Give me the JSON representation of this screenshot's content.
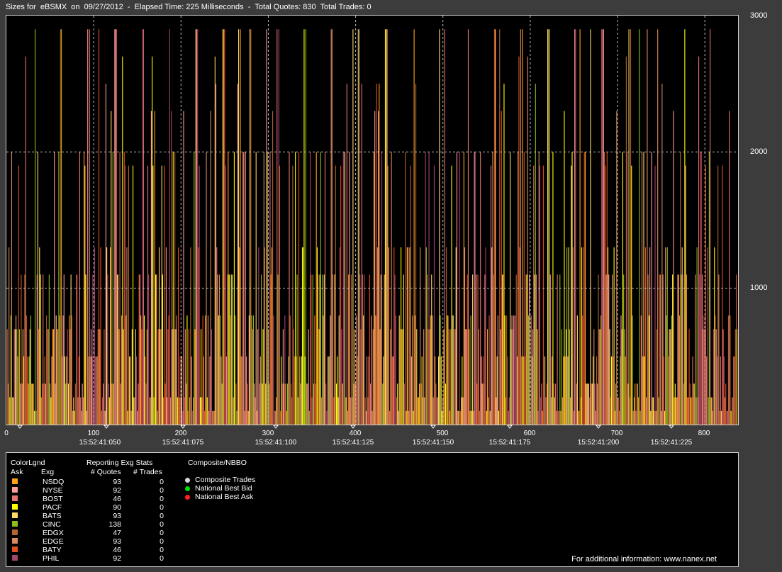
{
  "title": "Sizes for  eBSMX  on  09/27/2012  -  Elapsed Time: 225 Milliseconds  -  Total Quotes: 830  Total Trades: 0",
  "chart_data": {
    "type": "bar",
    "ylim": [
      0,
      3000
    ],
    "yticks": [
      "3000",
      "2000",
      "1000"
    ],
    "xlim": [
      0,
      838
    ],
    "xticks": [
      "0",
      "100",
      "200",
      "300",
      "400",
      "500",
      "600",
      "700",
      "800"
    ],
    "time_ticks": [
      "15:52:41:050",
      "15:52:41:075",
      "15:52:41:100",
      "15:52:41:125",
      "15:52:41:150",
      "15:52:41:175",
      "15:52:41:200",
      "15:52:41:225"
    ],
    "grid": true,
    "size_levels": [
      2900,
      2700,
      2500,
      2300,
      2000,
      1900,
      1300,
      1100,
      800,
      700,
      500,
      300,
      200,
      100
    ],
    "series_colors": [
      "#ff9f1a",
      "#ff9b9b",
      "#e57373",
      "#ffff00",
      "#ffd966",
      "#8fbc1f",
      "#b5642d",
      "#d98c5f",
      "#e0501f",
      "#a3466e"
    ]
  },
  "legend": {
    "color_legend_label": "ColorLgnd",
    "ask_label": "Ask",
    "exg_label": "Exg",
    "reporting_label": "Reporting Exg Stats",
    "quotes_label": "# Quotes",
    "trades_label": "# Trades",
    "composite_label": "Composite/NBBO",
    "exchanges": [
      {
        "name": "NSDQ",
        "quotes": "93",
        "trades": "0",
        "color": "#ff9f1a"
      },
      {
        "name": "NYSE",
        "quotes": "92",
        "trades": "0",
        "color": "#ff9b9b"
      },
      {
        "name": "BOST",
        "quotes": "46",
        "trades": "0",
        "color": "#e57373"
      },
      {
        "name": "PACF",
        "quotes": "90",
        "trades": "0",
        "color": "#ffff00"
      },
      {
        "name": "BATS",
        "quotes": "93",
        "trades": "0",
        "color": "#ffd966"
      },
      {
        "name": "CINC",
        "quotes": "138",
        "trades": "0",
        "color": "#8fbc1f"
      },
      {
        "name": "EDGX",
        "quotes": "47",
        "trades": "0",
        "color": "#b5642d"
      },
      {
        "name": "EDGE",
        "quotes": "93",
        "trades": "0",
        "color": "#d98c5f"
      },
      {
        "name": "BATY",
        "quotes": "46",
        "trades": "0",
        "color": "#e0501f"
      },
      {
        "name": "PHIL",
        "quotes": "92",
        "trades": "0",
        "color": "#a3466e"
      }
    ],
    "nbbo": [
      {
        "label": "Composite Trades",
        "color": "#d8d8d8"
      },
      {
        "label": "National Best Bid",
        "color": "#00e000"
      },
      {
        "label": "National Best Ask",
        "color": "#ff2020"
      }
    ],
    "footer": "For additional information: www.nanex.net"
  }
}
